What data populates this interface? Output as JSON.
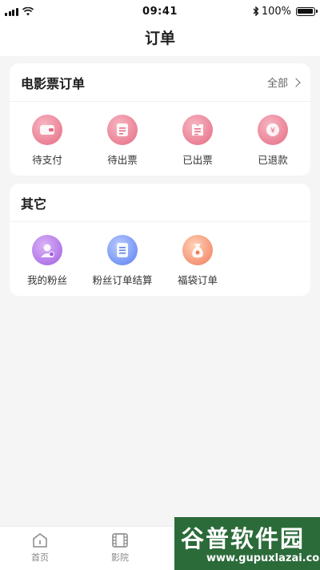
{
  "status_bar": {
    "time": "09:41",
    "battery_text": "100%"
  },
  "nav": {
    "title": "订单"
  },
  "movie_orders": {
    "title": "电影票订单",
    "more_label": "全部",
    "items": [
      {
        "label": "待支付",
        "icon": "wallet-icon",
        "color": "#e56a82"
      },
      {
        "label": "待出票",
        "icon": "ticket-pending-icon",
        "color": "#e56a82"
      },
      {
        "label": "已出票",
        "icon": "ticket-issued-icon",
        "color": "#e56a82"
      },
      {
        "label": "已退款",
        "icon": "refund-icon",
        "color": "#e56a82"
      }
    ]
  },
  "other": {
    "title": "其它",
    "items": [
      {
        "label": "我的粉丝",
        "icon": "fans-icon",
        "color": "#a15ee0"
      },
      {
        "label": "粉丝订单结算",
        "icon": "settlement-icon",
        "color": "#5a7ef0"
      },
      {
        "label": "福袋订单",
        "icon": "lucky-bag-icon",
        "color": "#f07a5a"
      }
    ]
  },
  "tabbar": {
    "items": [
      {
        "label": "首页",
        "icon": "home-icon"
      },
      {
        "label": "影院",
        "icon": "cinema-icon"
      },
      {
        "label": "",
        "icon": ""
      },
      {
        "label": "",
        "icon": ""
      }
    ]
  },
  "watermark": {
    "main": "谷普软件园",
    "url": "www.gupuxlazai.com"
  }
}
